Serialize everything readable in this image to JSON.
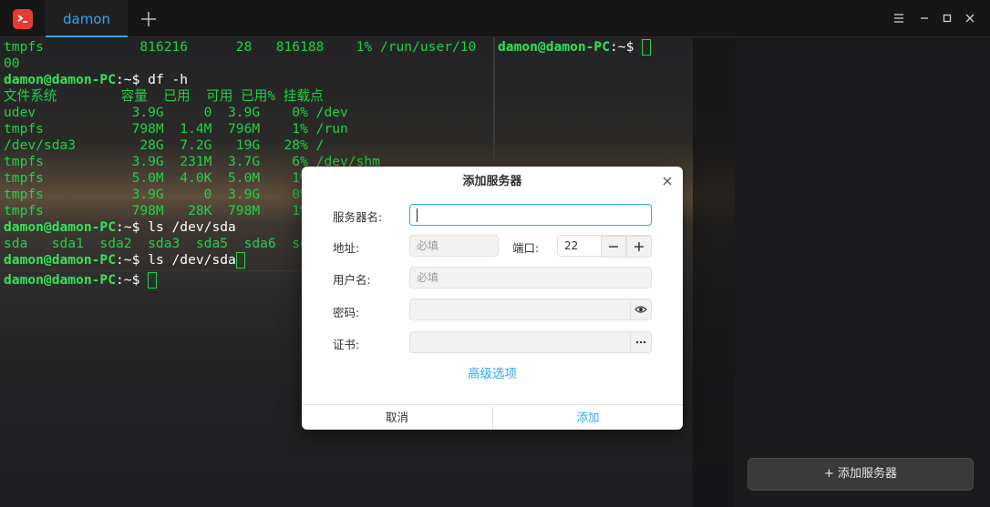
{
  "titlebar": {
    "tab_label": "damon",
    "icons": [
      "terminal-app-icon",
      "add-tab-icon",
      "menu-icon",
      "minimize-icon",
      "maximize-icon",
      "close-icon"
    ]
  },
  "terminal": {
    "left_pane": [
      {
        "t": "tmpfs            816216      28   816188    1% /run/user/10"
      },
      {
        "t": "00"
      },
      {
        "user": "damon@damon-PC",
        "path": ":~",
        "cmd": "$ df -h"
      },
      {
        "t": "文件系统        容量  已用  可用 已用% 挂载点"
      },
      {
        "t": "udev            3.9G     0  3.9G    0% /dev"
      },
      {
        "t": "tmpfs           798M  1.4M  796M    1% /run"
      },
      {
        "t": "/dev/sda3        28G  7.2G   19G   28% /"
      },
      {
        "t": "tmpfs           3.9G  231M  3.7G    6% /dev/shm"
      },
      {
        "t": "tmpfs           5.0M  4.0K  5.0M    1% /run/lock"
      },
      {
        "t": "tmpfs           3.9G     0  3.9G    0% /sys/fs/cgroup"
      },
      {
        "t": "tmpfs           798M   28K  798M    1% /run/user/1000"
      },
      {
        "user": "damon@damon-PC",
        "path": ":~",
        "cmd": "$ ls /dev/sda"
      },
      {
        "t": "sda   sda1  sda2  sda3  sda5  sda6  sda7"
      },
      {
        "user": "damon@damon-PC",
        "path": ":~",
        "cmd": "$ ls /dev/sda",
        "cursor": true
      }
    ],
    "right_pane": {
      "user": "damon@damon-PC",
      "path": ":~",
      "cmd": "$ "
    },
    "bottom_pane": {
      "user": "damon@damon-PC",
      "path": ":~",
      "cmd": "$ "
    }
  },
  "side_panel": {
    "add_server_label": "+ 添加服务器"
  },
  "dialog": {
    "title": "添加服务器",
    "server_name_label": "服务器名:",
    "server_name_value": "",
    "address_label": "地址:",
    "address_placeholder": "必填",
    "port_label": "端口:",
    "port_value": "22",
    "username_label": "用户名:",
    "username_placeholder": "必填",
    "password_label": "密码:",
    "certificate_label": "证书:",
    "advanced_link": "高级选项",
    "cancel_label": "取消",
    "add_label": "添加"
  },
  "colors": {
    "accent": "#2ca7f8",
    "terminal_green": "#20d14a",
    "logo_red": "#e63a35"
  }
}
